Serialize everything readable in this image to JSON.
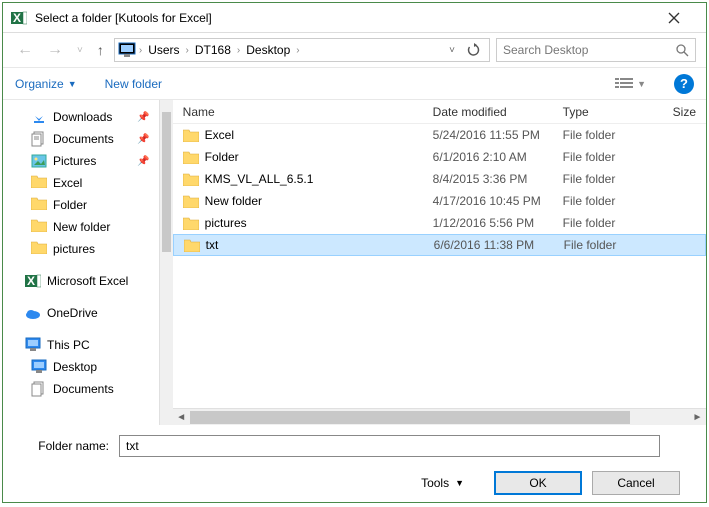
{
  "window": {
    "title": "Select a folder [Kutools for Excel]"
  },
  "address": {
    "segments": [
      "Users",
      "DT168",
      "Desktop"
    ]
  },
  "search": {
    "placeholder": "Search Desktop"
  },
  "toolbar": {
    "organize": "Organize",
    "new_folder": "New folder"
  },
  "columns": {
    "name": "Name",
    "date": "Date modified",
    "type": "Type",
    "size": "Size"
  },
  "nav": {
    "downloads": "Downloads",
    "documents": "Documents",
    "pictures": "Pictures",
    "excel": "Excel",
    "folder": "Folder",
    "new_folder": "New folder",
    "pictures2": "pictures",
    "ms_excel": "Microsoft Excel",
    "onedrive": "OneDrive",
    "this_pc": "This PC",
    "desktop": "Desktop",
    "documents2": "Documents"
  },
  "files": [
    {
      "name": "Excel",
      "date": "5/24/2016 11:55 PM",
      "type": "File folder",
      "selected": false
    },
    {
      "name": "Folder",
      "date": "6/1/2016 2:10 AM",
      "type": "File folder",
      "selected": false
    },
    {
      "name": "KMS_VL_ALL_6.5.1",
      "date": "8/4/2015 3:36 PM",
      "type": "File folder",
      "selected": false
    },
    {
      "name": "New folder",
      "date": "4/17/2016 10:45 PM",
      "type": "File folder",
      "selected": false
    },
    {
      "name": "pictures",
      "date": "1/12/2016 5:56 PM",
      "type": "File folder",
      "selected": false
    },
    {
      "name": "txt",
      "date": "6/6/2016 11:38 PM",
      "type": "File folder",
      "selected": true
    }
  ],
  "footer": {
    "folder_name_label": "Folder name:",
    "folder_name_value": "txt",
    "tools": "Tools",
    "ok": "OK",
    "cancel": "Cancel"
  }
}
